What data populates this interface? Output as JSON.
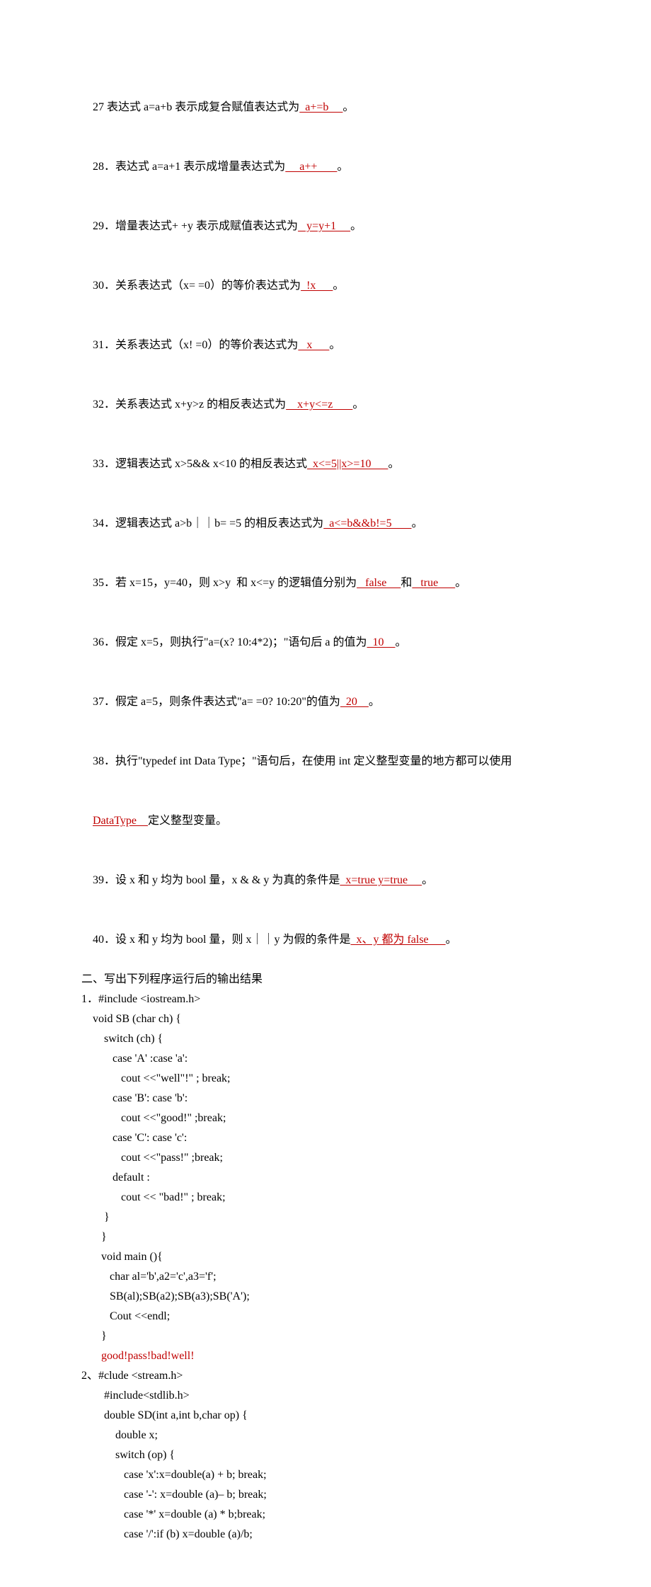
{
  "questions": [
    {
      "num": "27",
      "pre": " 表达式 a=a+b 表示成复合赋值表达式为",
      "ans": "  a+=b     ",
      "post": "。"
    },
    {
      "num": "28",
      "pre": "．表达式 a=a+1 表示成增量表达式为",
      "ans": "     a++       ",
      "post": "。"
    },
    {
      "num": "29",
      "pre": "．增量表达式+ +y 表示成赋值表达式为",
      "ans": "   y=y+1     ",
      "post": "。"
    },
    {
      "num": "30",
      "pre": "．关系表达式（x= =0）的等价表达式为",
      "ans": "  !x      ",
      "post": "。"
    },
    {
      "num": "31",
      "pre": "．关系表达式（x! =0）的等价表达式为",
      "ans": "   x      ",
      "post": "。"
    },
    {
      "num": "32",
      "pre": "．关系表达式 x+y>z 的相反表达式为",
      "ans": "    x+y<=z       ",
      "post": "。"
    },
    {
      "num": "33",
      "pre": "．逻辑表达式 x>5&& x<10 的相反表达式",
      "ans": "  x<=5||x>=10      ",
      "post": "。"
    },
    {
      "num": "34",
      "pre": "．逻辑表达式 a>b｜｜b= =5 的相反表达式为",
      "ans": "  a<=b&&b!=5       ",
      "post": "。"
    }
  ],
  "q35": {
    "num": "35",
    "pre": "．若 x=15，y=40，则 x>y  和 x<=y 的逻辑值分别为",
    "ans1": "   false     ",
    "mid": "和",
    "ans2": "   true      ",
    "post": "。"
  },
  "q36": {
    "num": "36",
    "pre": "．假定 x=5，则执行\"a=(x? 10:4*2)；\"语句后 a 的值为",
    "ans": "  10    ",
    "post": "。"
  },
  "q37": {
    "num": "37",
    "pre": "．假定 a=5，则条件表达式\"a= =0? 10:20\"的值为",
    "ans": "  20    ",
    "post": "。"
  },
  "q38": {
    "num": "38",
    "line1": "．执行\"typedef int Data Type；\"语句后，在使用 int 定义整型变量的地方都可以使用",
    "ans": "DataType    ",
    "line2": "定义整型变量。"
  },
  "q39": {
    "num": "39",
    "pre": "．设 x 和 y 均为 bool 量，x & & y 为真的条件是",
    "ans": "  x=true y=true     ",
    "post": "。"
  },
  "q40": {
    "num": "40",
    "pre": "．设 x 和 y 均为 bool 量，则 x｜｜y 为假的条件是",
    "ans": "  x、y 都为 false      ",
    "post": "。"
  },
  "section2_heading": "二、写出下列程序运行后的输出结果",
  "prog1": {
    "head": "1．#include <iostream.h>",
    "lines": [
      "    void SB (char ch) {",
      "        switch (ch) {",
      "           case 'A' :case 'a':",
      "              cout <<\"well\"!\" ; break;",
      "           case 'B': case 'b':",
      "              cout <<\"good!\" ;break;",
      "           case 'C': case 'c':",
      "              cout <<\"pass!\" ;break;",
      "           default :",
      "              cout << \"bad!\" ; break;",
      "        }",
      "       }",
      "       void main (){",
      "          char al='b',a2='c',a3='f';",
      "          SB(al);SB(a2);SB(a3);SB('A');",
      "          Cout <<endl;",
      "       }"
    ],
    "answer": "       good!pass!bad!well!"
  },
  "prog2": {
    "head": "2、#clude <stream.h>",
    "lines": [
      "        #include<stdlib.h>",
      "        double SD(int a,int b,char op) {",
      "            double x;",
      "            switch (op) {",
      "               case 'x':x=double(a) + b; break;",
      "               case '-': x=double (a)– b; break;",
      "               case '*' x=double (a) * b;break;",
      "               case '/':if (b) x=double (a)/b;"
    ]
  }
}
